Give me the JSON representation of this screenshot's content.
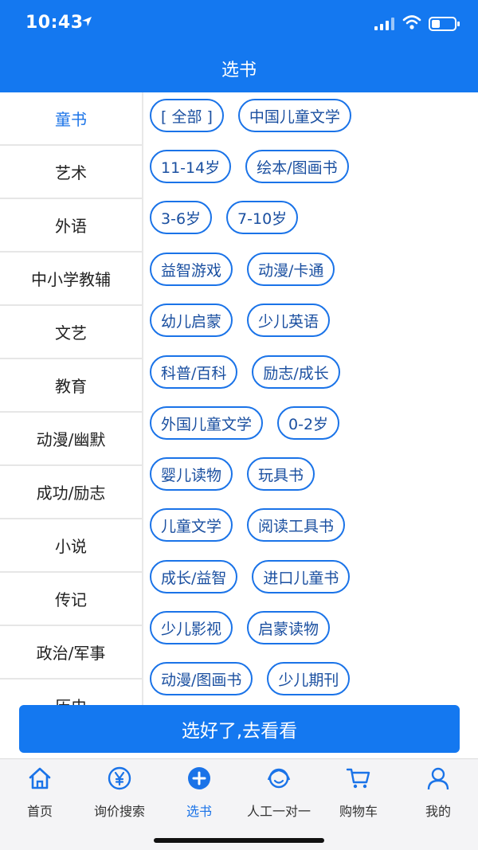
{
  "status_bar": {
    "time": "10:43"
  },
  "header": {
    "title": "选书"
  },
  "sidebar": {
    "items": [
      {
        "label": "童书",
        "active": true
      },
      {
        "label": "艺术"
      },
      {
        "label": "外语"
      },
      {
        "label": "中小学教辅"
      },
      {
        "label": "文艺"
      },
      {
        "label": "教育"
      },
      {
        "label": "动漫/幽默"
      },
      {
        "label": "成功/励志"
      },
      {
        "label": "小说"
      },
      {
        "label": "传记"
      },
      {
        "label": "政治/军事"
      },
      {
        "label": "历史"
      }
    ]
  },
  "tags": {
    "rows": [
      [
        "[ 全部 ]",
        "中国儿童文学"
      ],
      [
        "11-14岁",
        "绘本/图画书"
      ],
      [
        "3-6岁",
        "7-10岁"
      ],
      [
        "益智游戏",
        "动漫/卡通"
      ],
      [
        "幼儿启蒙",
        "少儿英语"
      ],
      [
        "科普/百科",
        "励志/成长"
      ],
      [
        "外国儿童文学",
        "0-2岁"
      ],
      [
        "婴儿读物",
        "玩具书"
      ],
      [
        "儿童文学",
        "阅读工具书"
      ],
      [
        "成长/益智",
        "进口儿童书"
      ],
      [
        "少儿影视",
        "启蒙读物"
      ],
      [
        "动漫/图画书",
        "少儿期刊"
      ]
    ]
  },
  "cta": {
    "label": "选好了,去看看"
  },
  "tabbar": {
    "items": [
      {
        "label": "首页",
        "icon": "home-icon"
      },
      {
        "label": "询价搜索",
        "icon": "yen-icon"
      },
      {
        "label": "选书",
        "icon": "plus-circle-icon",
        "active": true
      },
      {
        "label": "人工一对一",
        "icon": "chat-icon"
      },
      {
        "label": "购物车",
        "icon": "cart-icon"
      },
      {
        "label": "我的",
        "icon": "user-icon"
      }
    ]
  },
  "colors": {
    "primary": "#1478f0",
    "accent_text": "#1a73e8"
  }
}
